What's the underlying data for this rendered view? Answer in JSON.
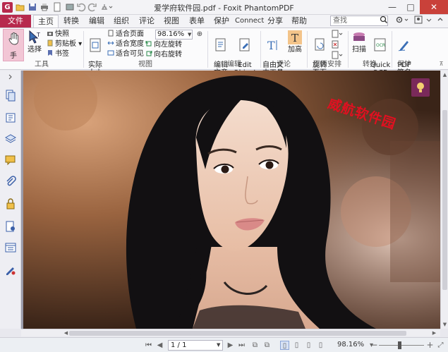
{
  "window": {
    "title": "爱学府软件园.pdf - Foxit PhantomPDF",
    "minimize": "—",
    "maximize": "□",
    "close": "✕"
  },
  "quick_access": [
    "open",
    "save",
    "print",
    "new",
    "undo",
    "redo",
    "stamp"
  ],
  "tabs": [
    {
      "label": "文件"
    },
    {
      "label": "主页"
    },
    {
      "label": "转换"
    },
    {
      "label": "编辑"
    },
    {
      "label": "组织"
    },
    {
      "label": "评论"
    },
    {
      "label": "视图"
    },
    {
      "label": "表单"
    },
    {
      "label": "保护"
    },
    {
      "label": "Connect"
    },
    {
      "label": "分享"
    },
    {
      "label": "帮助"
    }
  ],
  "search": {
    "placeholder": "查找"
  },
  "ribbon": {
    "tools": {
      "label": "工具",
      "hand": "手",
      "select": "选择",
      "snapshot": "快照",
      "clipboard": "剪贴板",
      "bookmark": "书签"
    },
    "view": {
      "label": "视图",
      "actual_size": "实际\n大小",
      "fit_page": "适合页面",
      "fit_width": "适合宽度",
      "fit_visible": "适合可见",
      "zoom_value": "98.16%",
      "rotate_left": "向左旋转",
      "rotate_right": "向右旋转"
    },
    "edit": {
      "label": "编辑",
      "edit_text": "编辑\n文章",
      "edit_object": "Edit\nObject"
    },
    "comment": {
      "label": "评论",
      "typewriter": "自由文\n本工具",
      "highlight": "加高"
    },
    "page": {
      "label": "页面安排",
      "rotate_page": "旋转\n页面"
    },
    "convert": {
      "label": "转换",
      "scan": "扫描",
      "ocr": "Quick\nOCR"
    },
    "protect": {
      "label": "保护",
      "sign": "PDF\n签名"
    }
  },
  "document": {
    "watermark": "威航软件园"
  },
  "statusbar": {
    "page_value": "1 / 1",
    "zoom": "98.16%",
    "zoom_level": 0.45
  },
  "colors": {
    "accent": "#b7294d",
    "watermark": "#e01020"
  }
}
